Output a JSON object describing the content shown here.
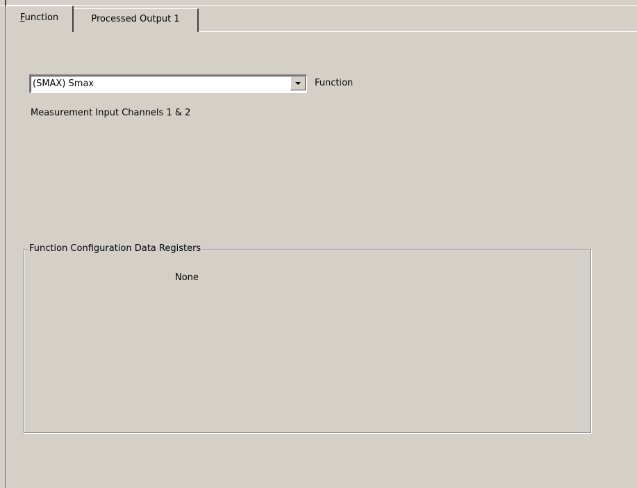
{
  "tabs": [
    {
      "label_ul": "F",
      "label_rest": "unction",
      "active": true
    },
    {
      "label": "Processed Output 1",
      "active": false
    }
  ],
  "function_select": {
    "value": "(SMAX) Smax",
    "label": "Function"
  },
  "measurement_text": "Measurement Input Channels 1 & 2",
  "config_group": {
    "title": "Function Configuration Data Registers",
    "content": "None"
  },
  "icons": {
    "dropdown": "chevron-down-icon"
  }
}
